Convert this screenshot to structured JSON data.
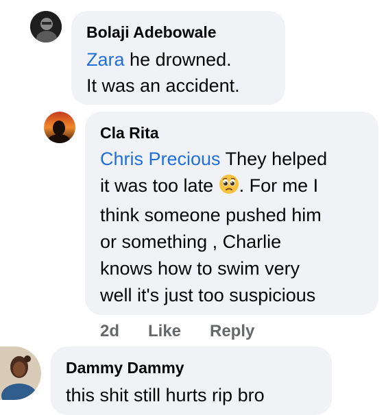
{
  "comments": [
    {
      "author": "Bolaji Adebowale",
      "mention": "Zara",
      "text_lines": [
        "he drowned.",
        "It was an accident."
      ]
    },
    {
      "author": "Cla Rita",
      "mention": "Chris Precious",
      "text_line1": "They helped",
      "text_line2_before_emoji": "it was too late",
      "emoji": "pleading-face-emoji",
      "text_line2_after_emoji": ". For me I",
      "text_lines_rest": [
        "think someone pushed him",
        "or something , Charlie",
        "knows how to swim very",
        "well it's just too suspicious"
      ],
      "actions": {
        "time": "2d",
        "like": "Like",
        "reply": "Reply"
      }
    },
    {
      "author": "Dammy Dammy",
      "text": "this shit still hurts rip bro"
    }
  ],
  "colors": {
    "bubble": "#f0f2f5",
    "mention": "#216fdb",
    "meta": "#65676b"
  }
}
